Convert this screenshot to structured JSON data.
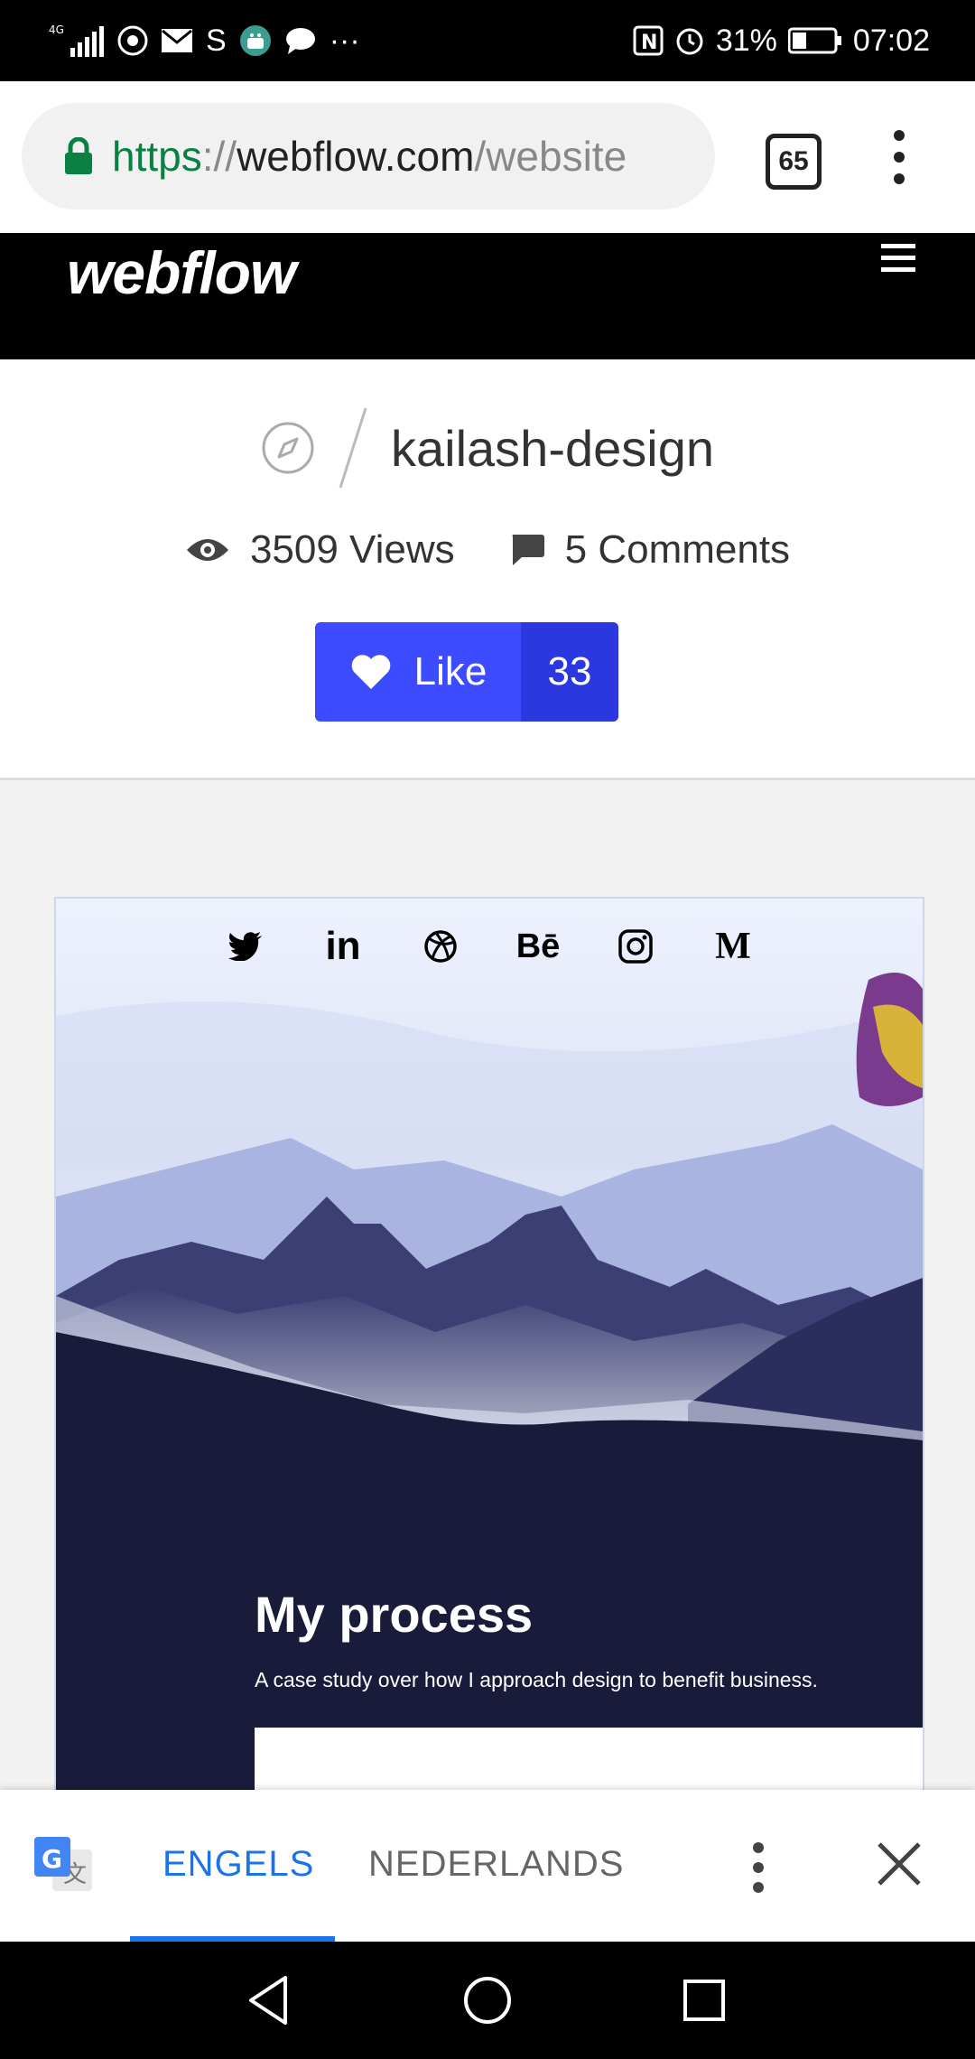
{
  "status_bar": {
    "network": "4G",
    "s_label": "S",
    "more": "···",
    "nfc": "N",
    "battery": "31%",
    "time": "07:02"
  },
  "browser": {
    "url_scheme": "https",
    "url_sep": "://",
    "url_host": "webflow.com",
    "url_path": "/website",
    "tab_count": "65"
  },
  "site": {
    "logo": "webflow"
  },
  "project": {
    "name": "kailash-design",
    "views": "3509 Views",
    "comments": "5 Comments",
    "like_label": "Like",
    "like_count": "33"
  },
  "preview": {
    "social": [
      "twitter-icon",
      "linkedin-icon",
      "dribbble-icon",
      "behance-icon",
      "instagram-icon",
      "medium-icon"
    ],
    "linkedin_text": "in",
    "behance_text": "Bē",
    "medium_text": "M",
    "title": "My process",
    "subtitle": "A case study over how I approach design to benefit business."
  },
  "translate": {
    "source_lang": "ENGELS",
    "target_lang": "NEDERLANDS",
    "accent": "#1a73e8"
  }
}
